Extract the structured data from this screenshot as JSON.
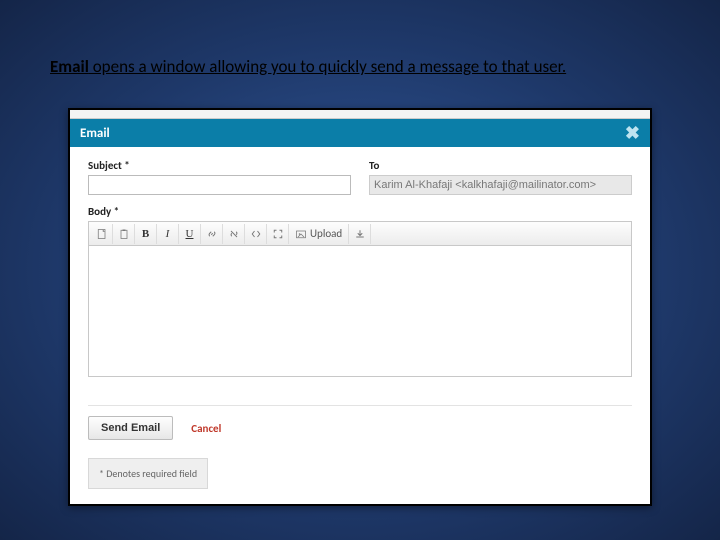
{
  "caption": {
    "bold": "Email",
    "rest": " opens a window allowing you to quickly send a message to that user."
  },
  "modal": {
    "title": "Email",
    "subject_label": "Subject *",
    "to_label": "To",
    "to_value": "Karim Al-Khafaji <kalkhafaji@mailinator.com>",
    "body_label": "Body *",
    "toolbar": {
      "upload": "Upload"
    },
    "send_label": "Send Email",
    "cancel_label": "Cancel",
    "footnote": "* Denotes required field"
  }
}
